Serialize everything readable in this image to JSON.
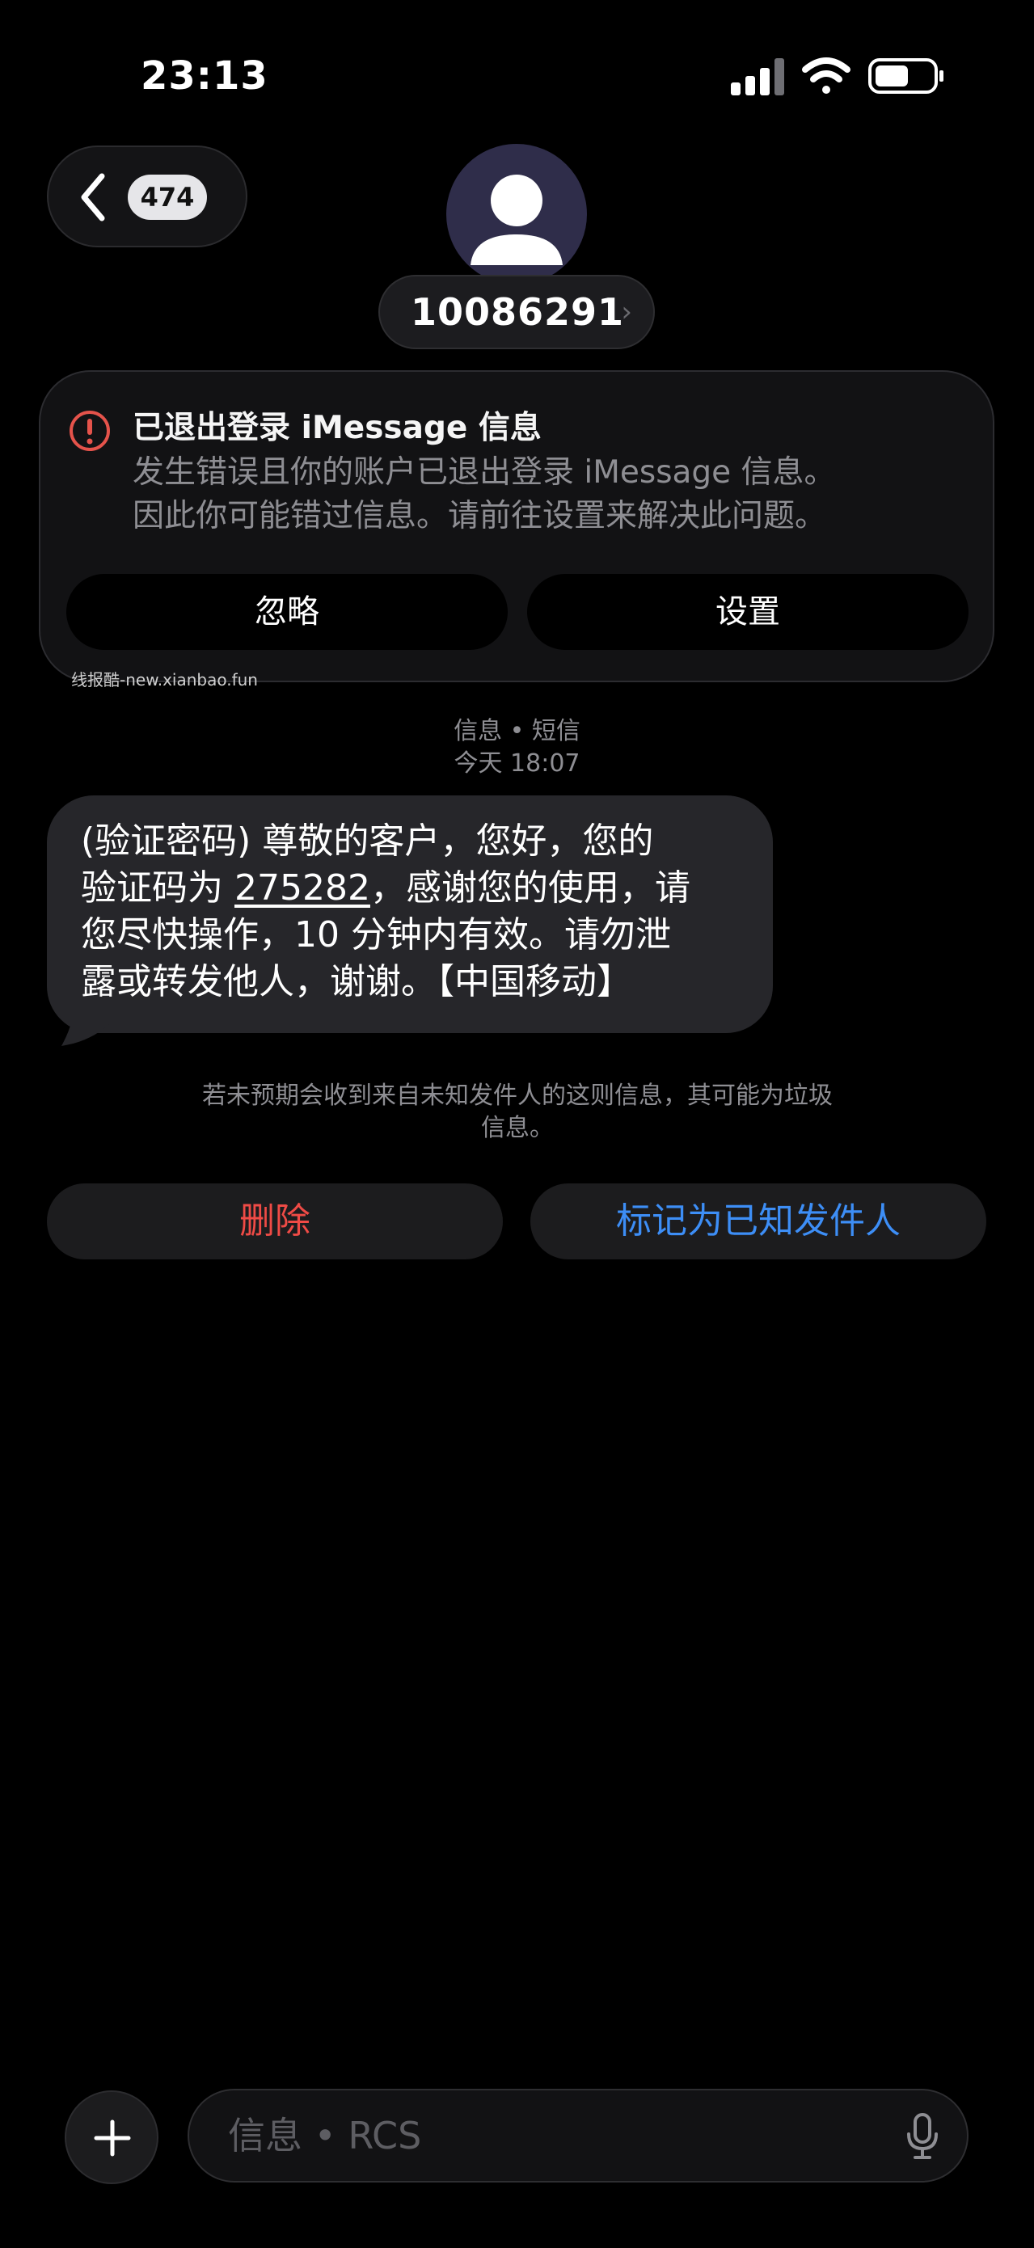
{
  "status_bar": {
    "time": "23:13",
    "icons": [
      "cellular-signal-icon",
      "wifi-icon",
      "battery-icon"
    ]
  },
  "nav": {
    "back_icon": "chevron-left-icon",
    "unread_count": "474"
  },
  "contact": {
    "avatar_icon": "person-silhouette-icon",
    "number": "10086291",
    "chevron": "›"
  },
  "error_card": {
    "icon": "exclamation-circle-icon",
    "title": "已退出登录 iMessage 信息",
    "body_line1": "发生错误且你的账户已退出登录 iMessage 信息。",
    "body_line2": "因此你可能错过信息。请前往设置来解决此问题。",
    "ignore_label": "忽略",
    "settings_label": "设置"
  },
  "watermark": "线报酷-new.xianbao.fun",
  "thread_meta": {
    "service": "信息 • 短信",
    "timestamp": "今天 18:07"
  },
  "message": {
    "line1": "(验证密码) 尊敬的客户，您好，您的",
    "line2_prefix": "验证码为 ",
    "code": "275282",
    "line2_suffix": "，感谢您的使用，请",
    "line3": "您尽快操作，10 分钟内有效。请勿泄",
    "line4": "露或转发他人，谢谢。【中国移动】"
  },
  "unknown_sender_notice": {
    "line1": "若未预期会收到来自未知发件人的这则信息，其可能为垃圾",
    "line2": "信息。"
  },
  "actions": {
    "delete_label": "删除",
    "mark_known_label": "标记为已知发件人"
  },
  "compose": {
    "plus_icon": "plus-icon",
    "placeholder": "信息 • RCS",
    "mic_icon": "microphone-icon"
  },
  "colors": {
    "background": "#000000",
    "bubble": "#26262a",
    "delete_red": "#ef4b46",
    "link_blue": "#3d8ef6",
    "error_red": "#e5534b",
    "secondary_text": "#8e8e93"
  }
}
